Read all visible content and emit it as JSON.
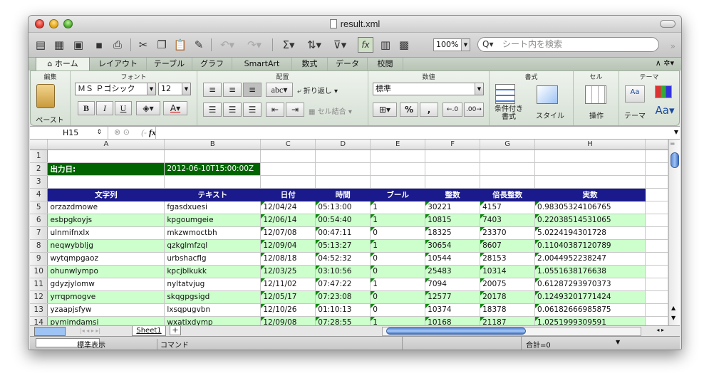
{
  "window": {
    "title": "result.xml"
  },
  "toolbar": {
    "zoom": "100%",
    "search_placeholder": "シート内を検索"
  },
  "tabs": [
    "ホーム",
    "レイアウト",
    "テーブル",
    "グラフ",
    "SmartArt",
    "数式",
    "データ",
    "校閲"
  ],
  "ribbon": {
    "groups": {
      "edit": "編集",
      "font": "フォント",
      "align": "配置",
      "number": "数値",
      "style": "書式",
      "cell": "セル",
      "theme": "テーマ"
    },
    "paste": "ペースト",
    "font_name": "ＭＳ Ｐゴシック",
    "font_size": "12",
    "wrap": "折り返し",
    "abc": "abc",
    "merge": "セル結合",
    "number_format": "標準",
    "cond_fmt": "条件付き\n書式",
    "style_btn": "スタイル",
    "ops": "操作",
    "theme_btn": "テーマ",
    "bold": "B",
    "italic": "I",
    "underline": "U",
    "font_color": "A",
    "percent": "%",
    "comma": ",",
    "aa": "Aa"
  },
  "formula": {
    "cell": "H15",
    "fx": "fx"
  },
  "columns": [
    "A",
    "B",
    "C",
    "D",
    "E",
    "F",
    "G",
    "H"
  ],
  "rows": [
    {
      "n": "1",
      "c": [
        "",
        "",
        "",
        "",
        "",
        "",
        "",
        ""
      ]
    },
    {
      "n": "2",
      "c": [
        "出力日:",
        "2012-06-10T15:00:00Z",
        "",
        "",
        "",
        "",
        "",
        ""
      ]
    },
    {
      "n": "3",
      "c": [
        "",
        "",
        "",
        "",
        "",
        "",
        "",
        ""
      ]
    },
    {
      "n": "4",
      "c": [
        "文字列",
        "テキスト",
        "日付",
        "時間",
        "ブール",
        "整数",
        "倍長整数",
        "実数"
      ]
    },
    {
      "n": "5",
      "c": [
        "orzazdmowe",
        "fgasdxuesi",
        "12/04/24",
        "05:13:00",
        "1",
        "30221",
        "4157",
        "0.98305324106765"
      ]
    },
    {
      "n": "6",
      "c": [
        "esbpgkoyjs",
        "kpgoumgeie",
        "12/06/14",
        "00:54:40",
        "1",
        "10815",
        "7403",
        "0.22038514531065"
      ]
    },
    {
      "n": "7",
      "c": [
        "ulnmifnxlx",
        "mkzwmoctbh",
        "12/07/08",
        "00:47:11",
        "0",
        "18325",
        "23370",
        "5.0224194301728"
      ]
    },
    {
      "n": "8",
      "c": [
        "neqwybbljg",
        "qzkglmfzql",
        "12/09/04",
        "05:13:27",
        "1",
        "30654",
        "8607",
        "0.11040387120789"
      ]
    },
    {
      "n": "9",
      "c": [
        "wytqmpgaoz",
        "urbshacflg",
        "12/08/18",
        "04:52:32",
        "0",
        "10544",
        "28153",
        "2.0044952238247"
      ]
    },
    {
      "n": "10",
      "c": [
        "ohunwlympo",
        "kpcjblkukk",
        "12/03/25",
        "03:10:56",
        "0",
        "25483",
        "10314",
        "1.0551638176638"
      ]
    },
    {
      "n": "11",
      "c": [
        "gdyzjylomw",
        "nyltatvjug",
        "12/11/02",
        "07:47:22",
        "1",
        "7094",
        "20075",
        "0.61287293970373"
      ]
    },
    {
      "n": "12",
      "c": [
        "yrrqpmogve",
        "skqgpgsigd",
        "12/05/17",
        "07:23:08",
        "0",
        "12577",
        "20178",
        "0.12493201771424"
      ]
    },
    {
      "n": "13",
      "c": [
        "yzaapjsfyw",
        "lxsqpugvbn",
        "12/10/26",
        "01:10:13",
        "0",
        "10374",
        "18378",
        "0.06182666985875"
      ]
    },
    {
      "n": "14",
      "c": [
        "pymimdamsi",
        "wxatixdymp",
        "12/09/08",
        "07:28:55",
        "1",
        "10168",
        "21187",
        "1.0251999309591"
      ]
    }
  ],
  "sheet_tab": "Sheet1",
  "status": {
    "mode": "標準表示",
    "command": "コマンド",
    "sum": "合計=0"
  }
}
